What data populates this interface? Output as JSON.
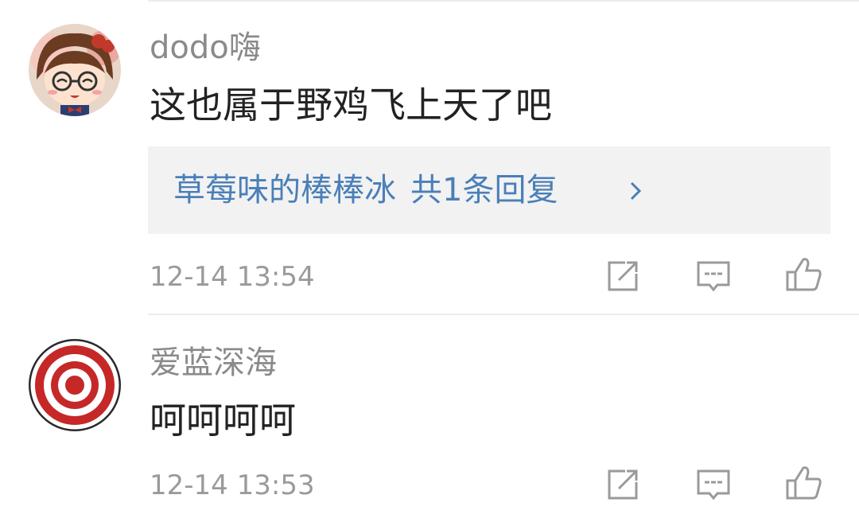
{
  "comments": [
    {
      "username": "dodo嗨",
      "content": "这也属于野鸡飞上天了吧",
      "reply": {
        "author": "草莓味的棒棒冰",
        "count_text": "共1条回复"
      },
      "timestamp": "12-14 13:54",
      "avatar_icon": "cartoon-girl-avatar"
    },
    {
      "username": "爱蓝深海",
      "content": "呵呵呵呵",
      "timestamp": "12-14 13:53",
      "avatar_icon": "red-target-avatar"
    }
  ],
  "actions": {
    "share_icon": "share-icon",
    "reply_icon": "comment-icon",
    "like_icon": "thumbs-up-icon"
  },
  "colors": {
    "username": "#8a8a8a",
    "content": "#222222",
    "reply_link": "#4a7fb8",
    "reply_bg": "#f2f2f2",
    "timestamp": "#9a9a9a",
    "icon": "#9a9a9a"
  }
}
